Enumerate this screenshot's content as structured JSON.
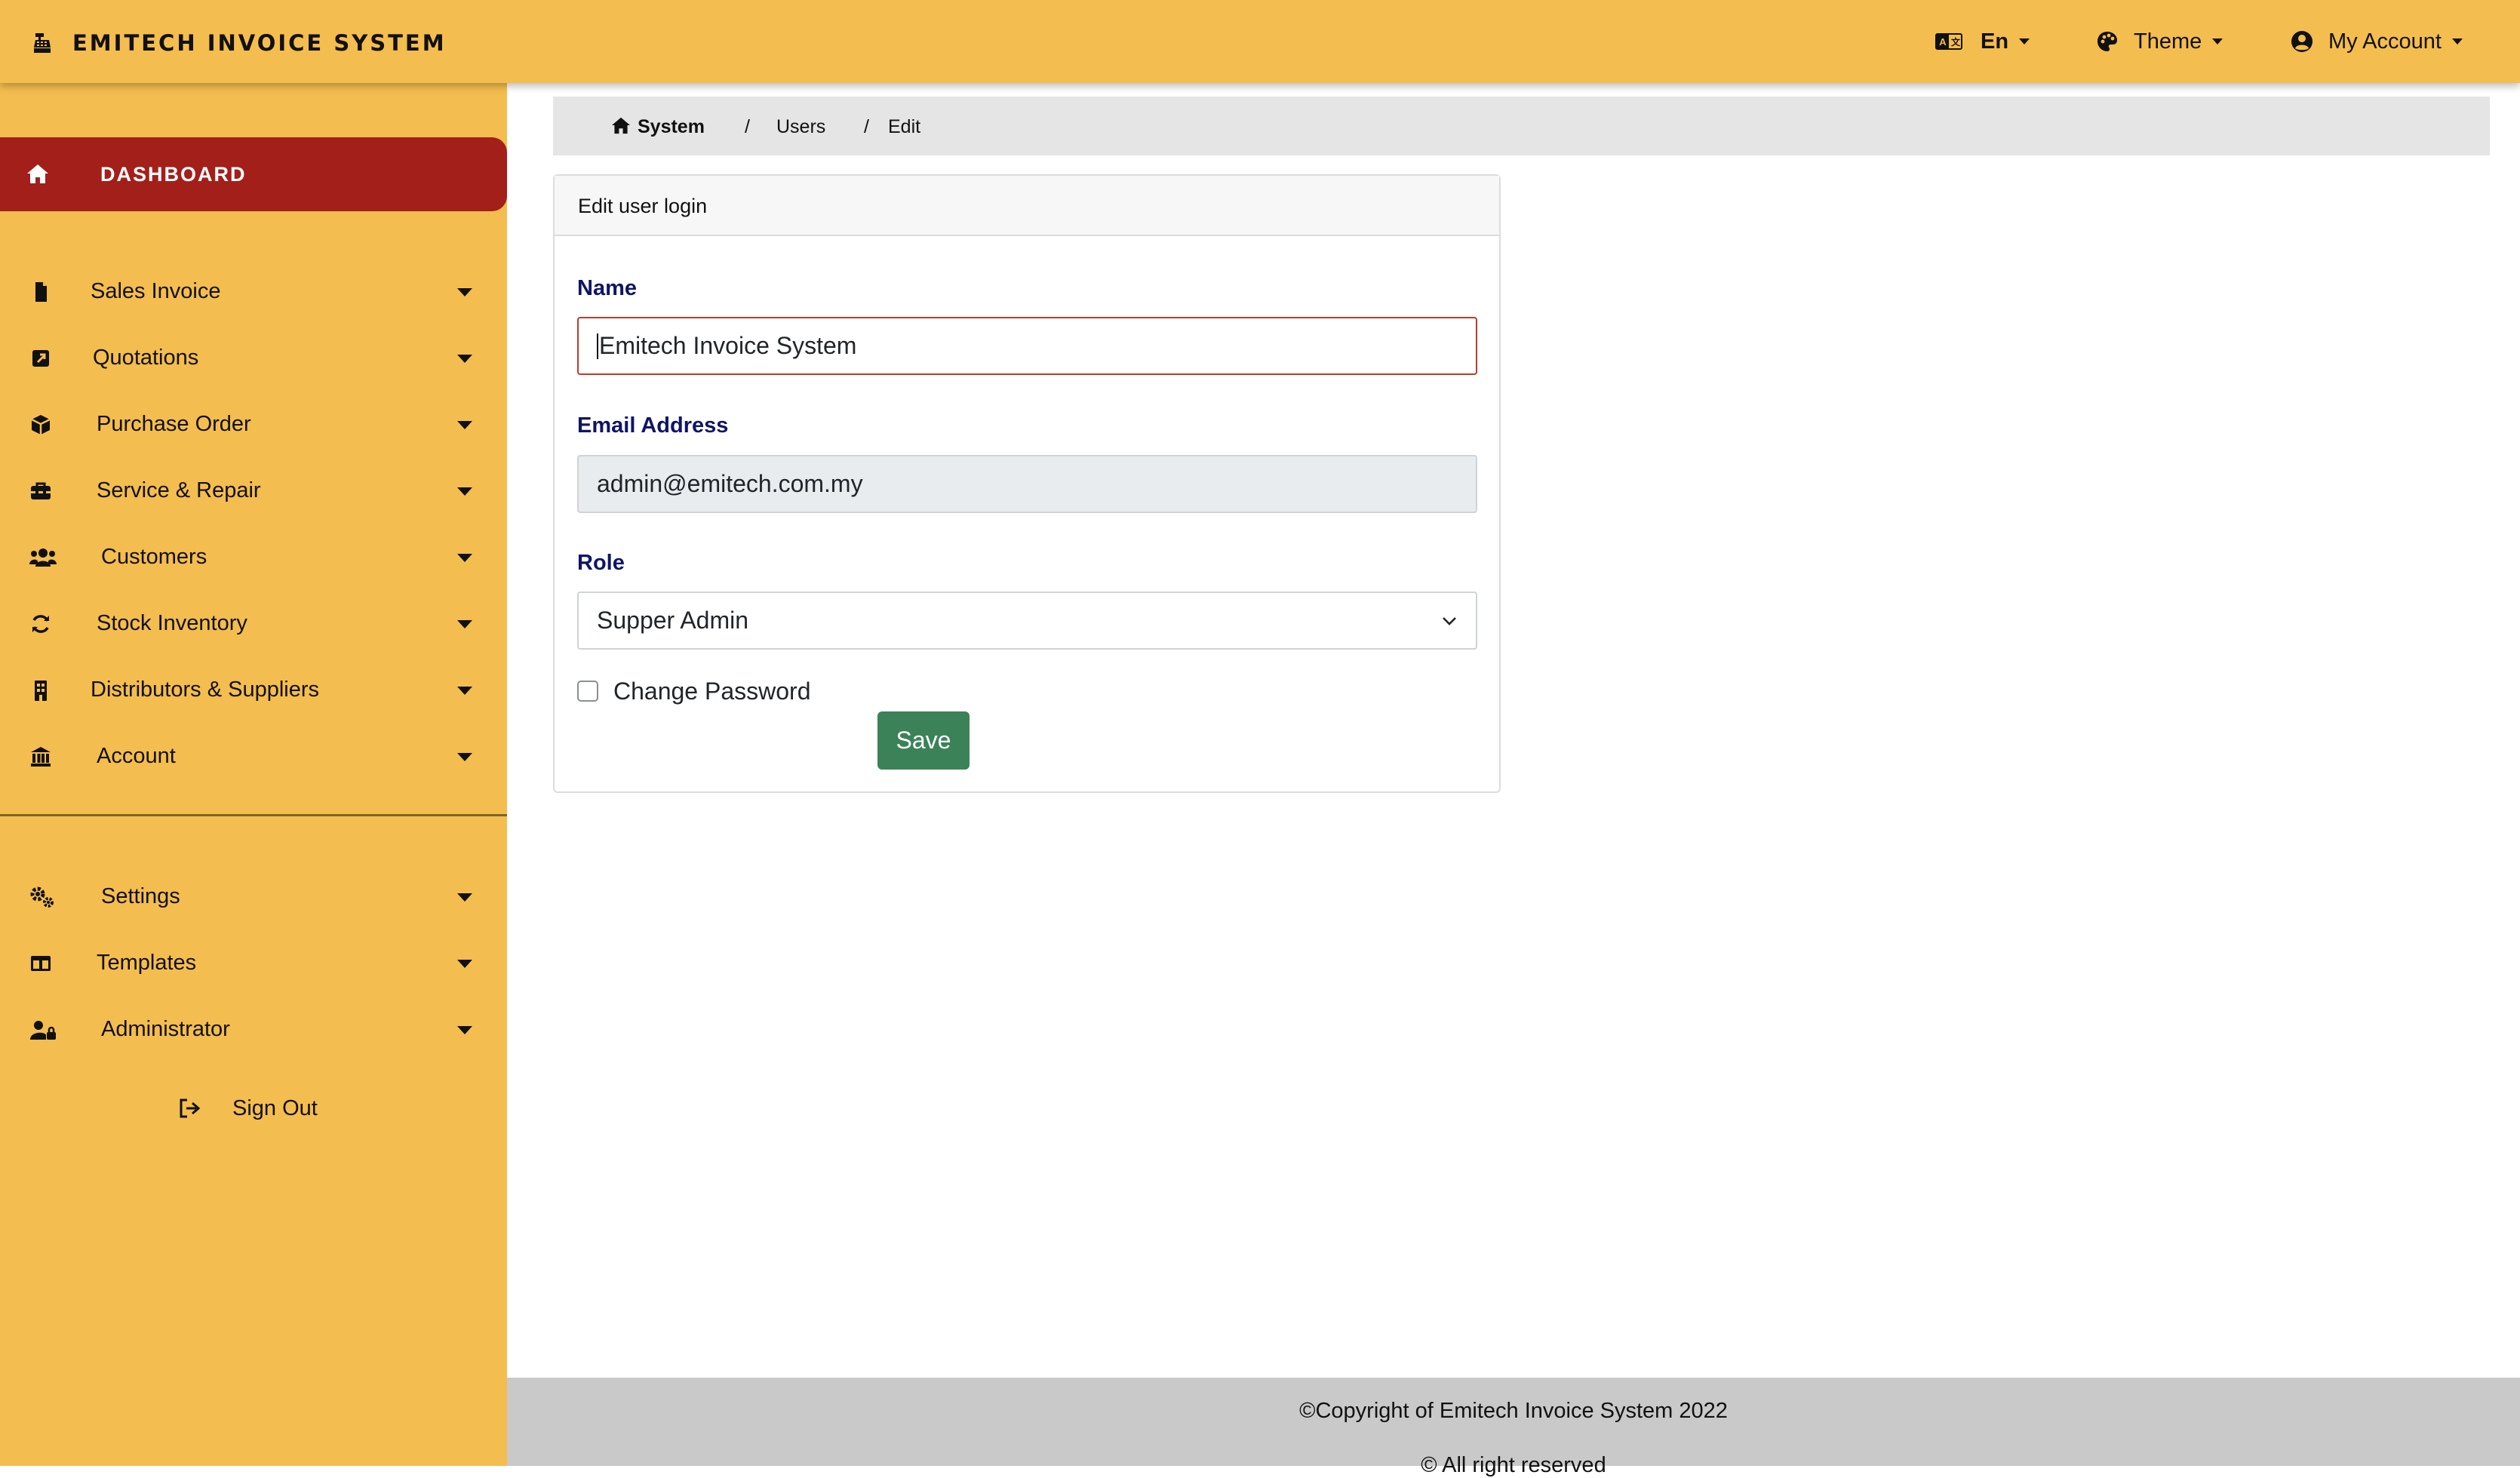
{
  "header": {
    "brand": "EMITECH INVOICE SYSTEM",
    "language": "En",
    "theme": "Theme",
    "account": "My Account"
  },
  "sidebar": {
    "dashboard": "DASHBOARD",
    "items": [
      {
        "label": "Sales Invoice",
        "icon": "file-icon"
      },
      {
        "label": "Quotations",
        "icon": "external-link-square-icon"
      },
      {
        "label": "Purchase Order",
        "icon": "box-icon"
      },
      {
        "label": "Service & Repair",
        "icon": "toolbox-icon"
      },
      {
        "label": "Customers",
        "icon": "users-icon"
      },
      {
        "label": "Stock Inventory",
        "icon": "sync-icon"
      },
      {
        "label": "Distributors & Suppliers",
        "icon": "building-icon"
      },
      {
        "label": "Account",
        "icon": "bank-icon"
      }
    ],
    "admin_items": [
      {
        "label": "Settings",
        "icon": "cogs-icon"
      },
      {
        "label": "Templates",
        "icon": "table-icon"
      },
      {
        "label": "Administrator",
        "icon": "user-lock-icon"
      }
    ],
    "sign_out": "Sign Out"
  },
  "breadcrumb": {
    "home": "System",
    "separator": "/",
    "users": "Users",
    "current": "Edit"
  },
  "form": {
    "title": "Edit user login",
    "name_label": "Name",
    "name_value": "Emitech Invoice System",
    "email_label": "Email Address",
    "email_value": "admin@emitech.com.my",
    "role_label": "Role",
    "role_value": "Supper Admin",
    "change_password_label": "Change Password",
    "change_password_checked": false,
    "save_label": "Save"
  },
  "footer": {
    "copyright": "©Copyright of Emitech Invoice System 2022",
    "rights": "© All right reserved"
  },
  "colors": {
    "topbar": "#f4bd4f",
    "sidebar": "#f4bd4f",
    "dashboard_active": "#a31f1a",
    "label_text": "#0f1565",
    "save_button": "#3b8258",
    "footer": "#c9c9c9",
    "breadcrumb_bg": "#e5e5e5"
  }
}
